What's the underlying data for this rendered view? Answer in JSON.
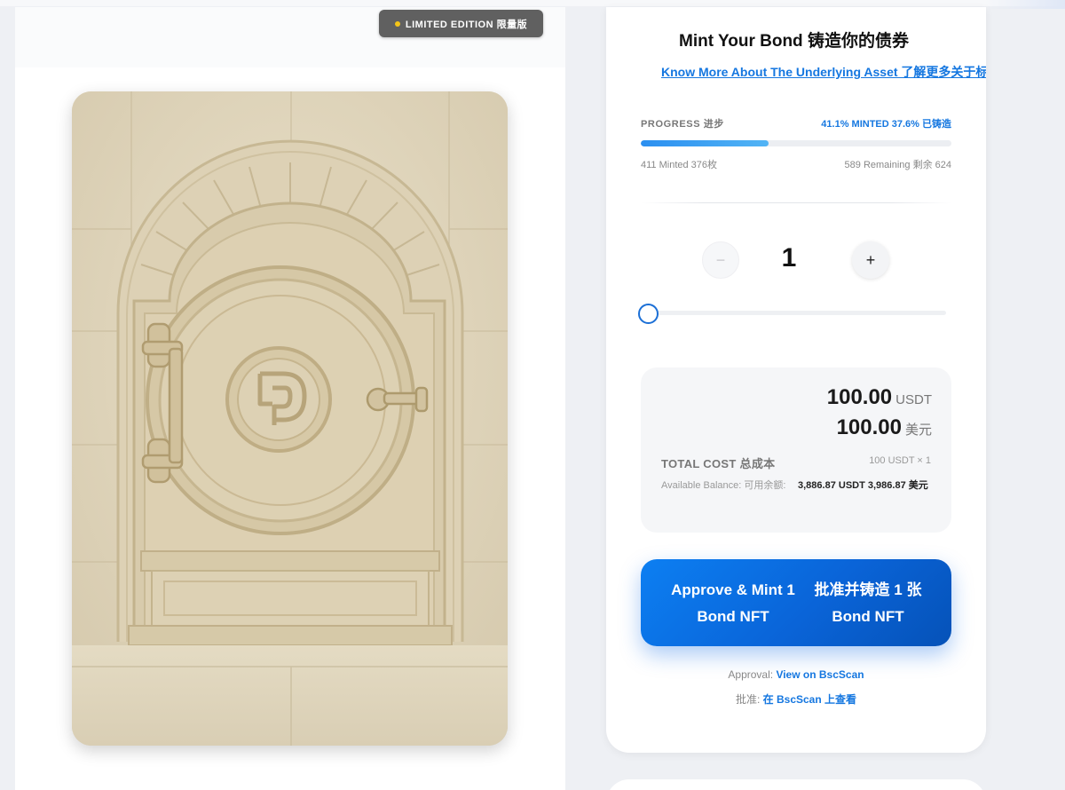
{
  "badge": {
    "label": "LIMITED EDITION  限量版"
  },
  "vault_image": {
    "alt": "vault-door-illustration",
    "logo_icon": "d-logo-icon"
  },
  "mint": {
    "title": "Mint Your Bond  铸造你的债券",
    "know_more_link": "Know More About The Underlying Asset  了解更多关于标的资产的"
  },
  "progress": {
    "label": "PROGRESS  进步",
    "percent_text": "41.1% MINTED  37.6% 已铸造",
    "fraction": 0.411,
    "minted_text": "411 Minted  376枚",
    "remaining_text": "589 Remaining  剩余 624"
  },
  "quantity": {
    "minus_label": "−",
    "value": "1",
    "plus_label": "+",
    "slider_value": 0
  },
  "cost": {
    "amount_usdt": "100.00",
    "unit_usdt": "USDT",
    "amount_cny": "100.00",
    "unit_cny": "美元",
    "total_label": "TOTAL COST  总成本",
    "multiplier": "100 USDT × 1",
    "balance_label": "Available Balance:  可用余额:",
    "balance_value": "3,886.87 USDT  3,986.87 美元"
  },
  "action": {
    "button_en": "Approve & Mint 1 Bond NFT",
    "button_zh": "批准并铸造 1 张 Bond NFT",
    "approval_prefix_en": "Approval: ",
    "approval_link_en": "View on BscScan",
    "approval_prefix_zh": "批准: ",
    "approval_link_zh": "在 BscScan 上查看"
  },
  "colors": {
    "accent": "#1577e0",
    "button_gradient_start": "#0c7ff2",
    "button_gradient_end": "#0552b8",
    "badge_bg": "#606060",
    "badge_dot": "#f5c518",
    "vault_beige": "#ddd2b8"
  }
}
